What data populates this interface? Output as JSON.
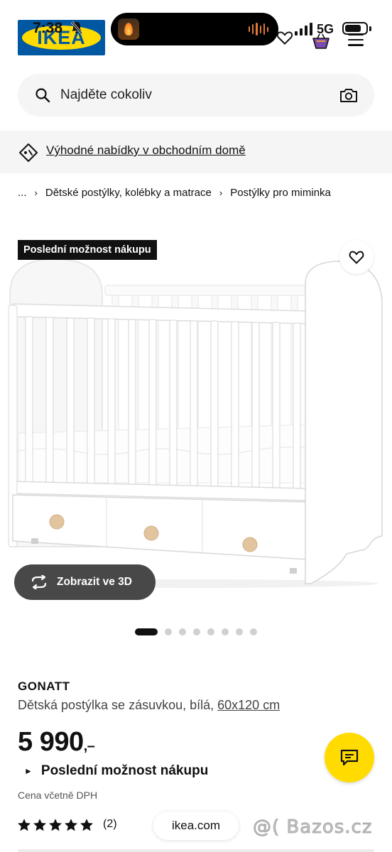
{
  "status_bar": {
    "time": "7:38",
    "network": "5G"
  },
  "header": {
    "logo_text": "IKEA"
  },
  "search": {
    "placeholder": "Najděte cokoliv"
  },
  "promo": {
    "link_text": "Výhodné nabídky v obchodním domě"
  },
  "breadcrumb": {
    "items": [
      "...",
      "Dětské postýlky, kolébky a matrace",
      "Postýlky pro miminka"
    ]
  },
  "product": {
    "badge": "Poslední možnost nákupu",
    "view3d_label": "Zobrazit ve 3D",
    "gallery_count": 8,
    "gallery_active_index": 0,
    "brand": "GONATT",
    "description": "Dětská postýlka se zásuvkou, bílá, ",
    "size": "60x120 cm",
    "price": "5 990",
    "price_suffix": ",–",
    "availability": "Poslední možnost nákupu",
    "vat_note": "Cena včetně DPH",
    "rating": 5,
    "review_count": "(2)"
  },
  "browser": {
    "url": "ikea.com"
  },
  "watermark": {
    "text": "@( Bazos.cz"
  },
  "colors": {
    "ikea_blue": "#0058a3",
    "ikea_yellow": "#ffdb00",
    "badge_bg": "#111111",
    "button_3d_bg": "#484848"
  }
}
